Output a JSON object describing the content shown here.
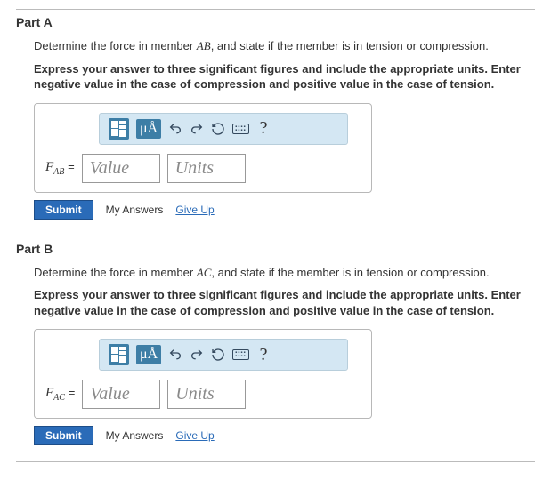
{
  "parts": [
    {
      "title": "Part A",
      "prompt_pre": "Determine the force in member ",
      "member": "AB",
      "prompt_post": ", and state if the member is in tension or compression.",
      "instructions": "Express your answer to three significant figures and include the appropriate units. Enter negative value in the case of compression and positive value in the case of tension.",
      "var_letter": "F",
      "var_sub": "AB",
      "equals": "=",
      "value_placeholder": "Value",
      "units_placeholder": "Units",
      "toolbar_units": "μÅ",
      "help": "?",
      "submit": "Submit",
      "my_answers": "My Answers",
      "give_up": "Give Up"
    },
    {
      "title": "Part B",
      "prompt_pre": "Determine the force in member ",
      "member": "AC",
      "prompt_post": ", and state if the member is in tension or compression.",
      "instructions": "Express your answer to three significant figures and include the appropriate units. Enter negative value in the case of compression and positive value in the case of tension.",
      "var_letter": "F",
      "var_sub": "AC",
      "equals": "=",
      "value_placeholder": "Value",
      "units_placeholder": "Units",
      "toolbar_units": "μÅ",
      "help": "?",
      "submit": "Submit",
      "my_answers": "My Answers",
      "give_up": "Give Up"
    }
  ]
}
